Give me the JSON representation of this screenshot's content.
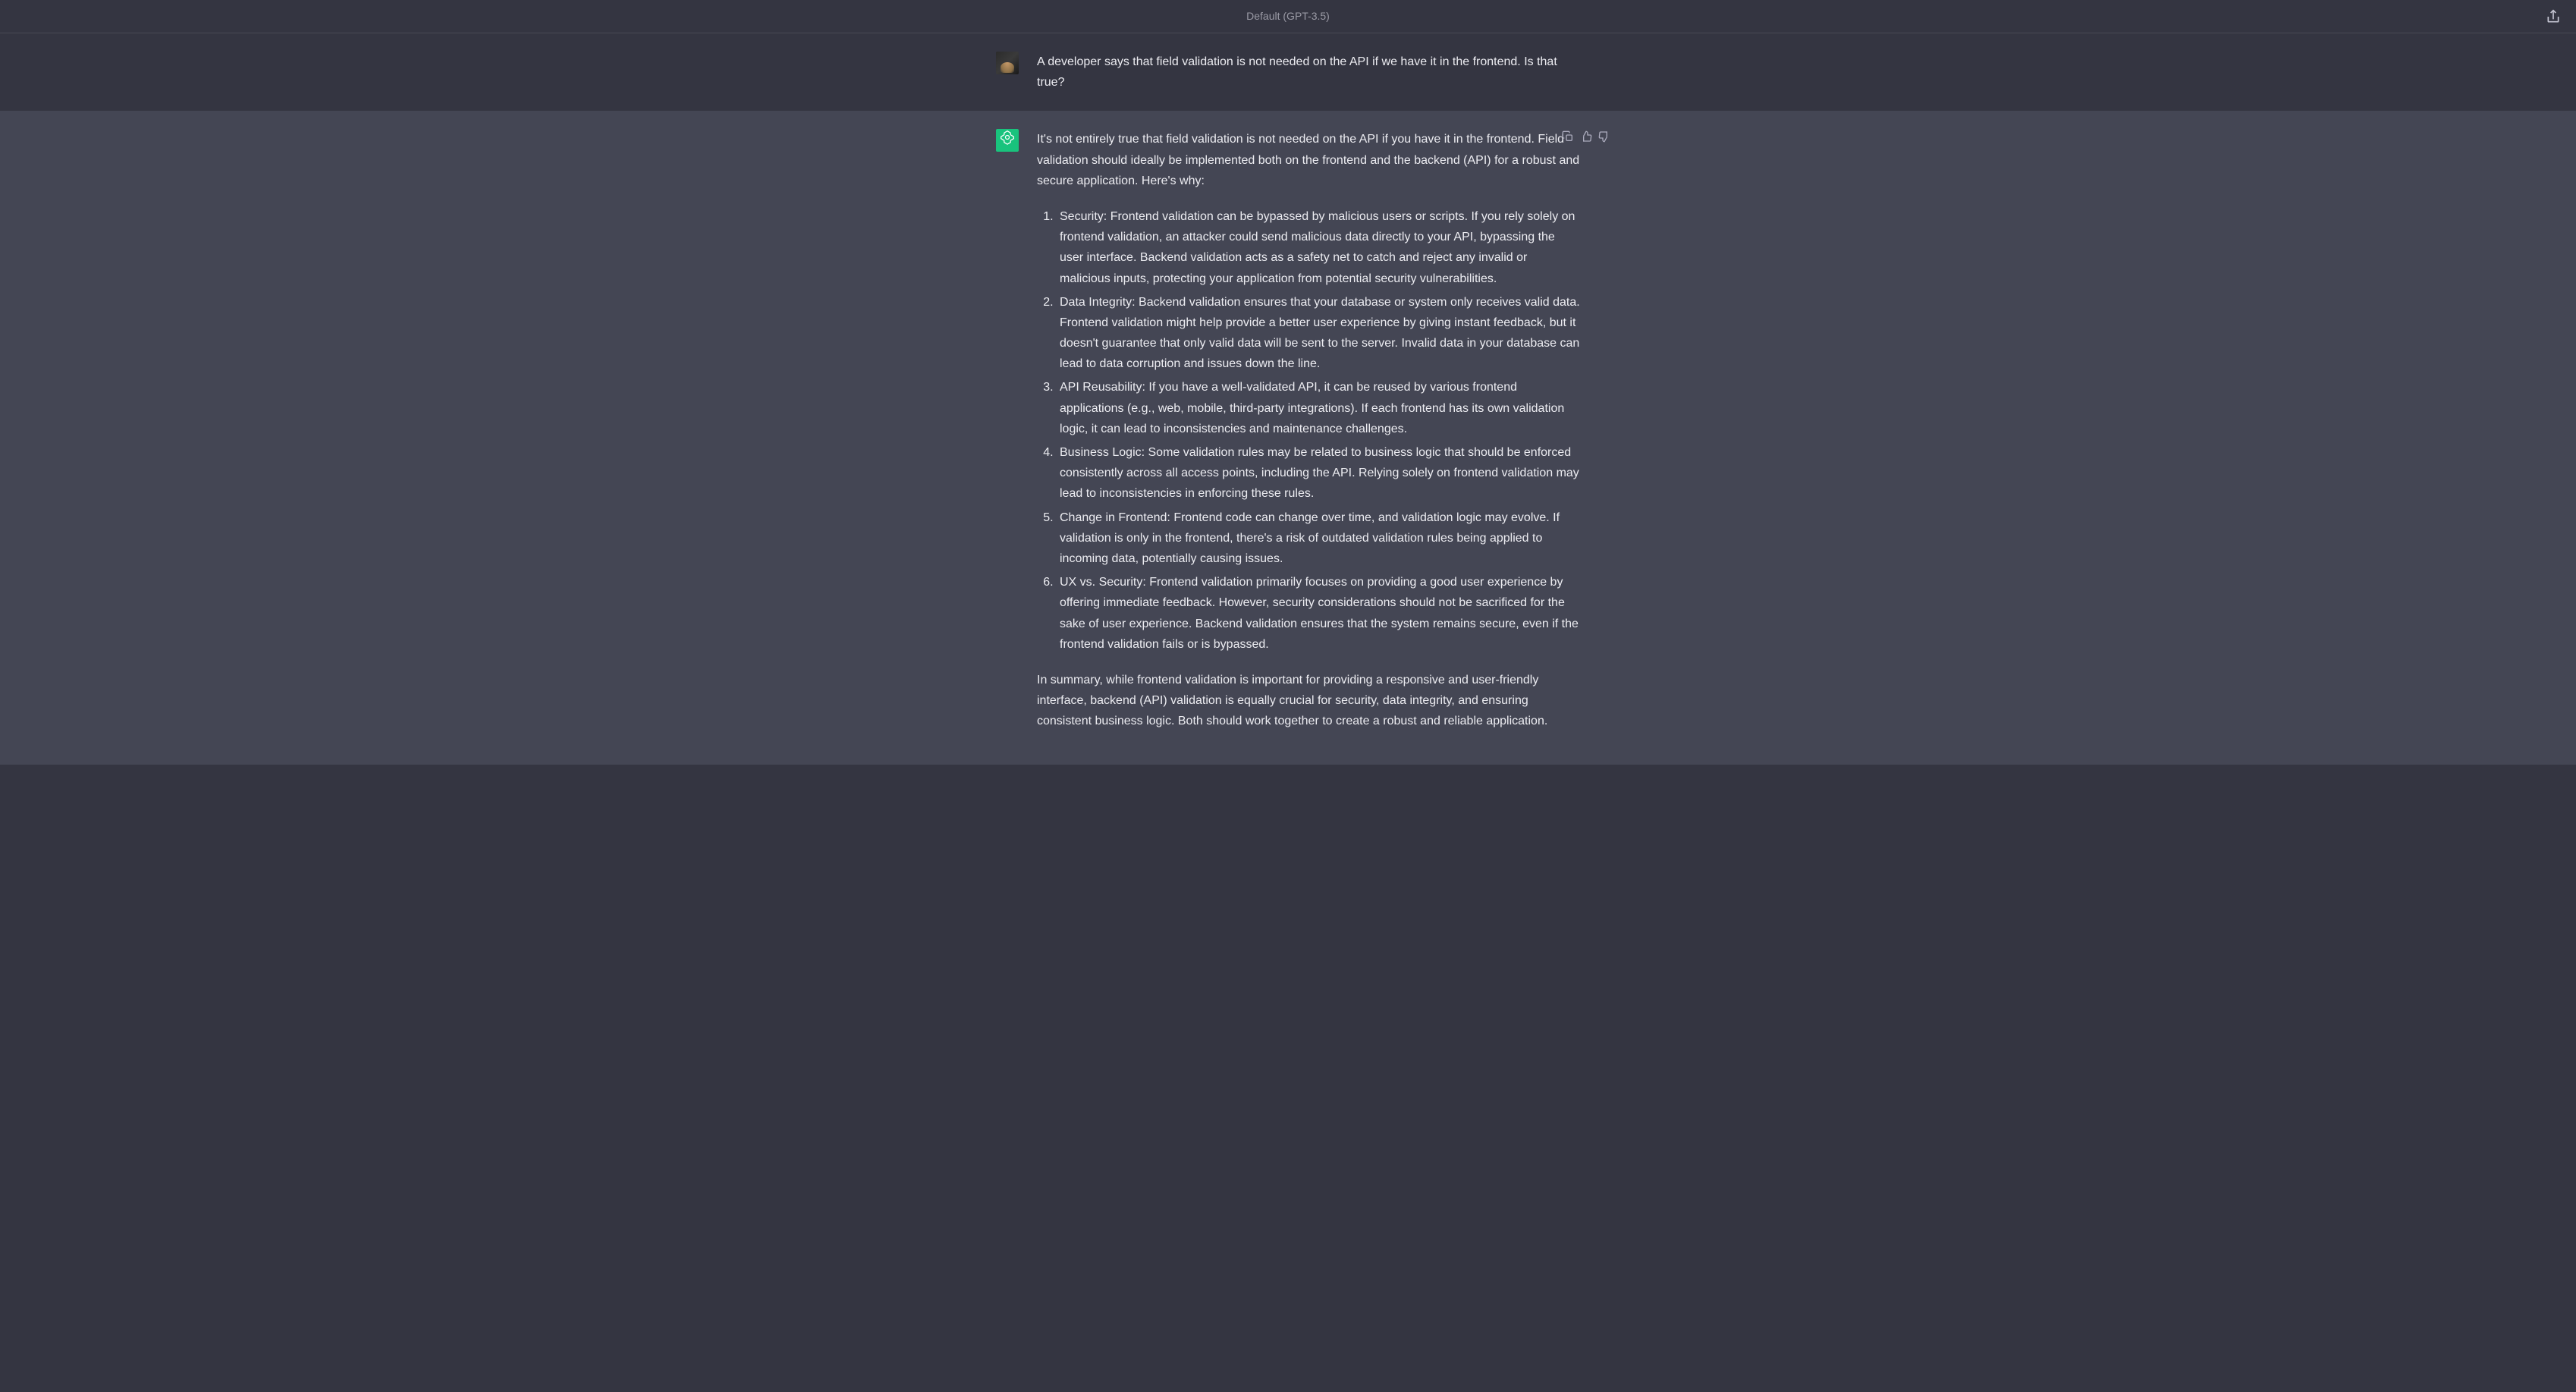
{
  "topbar": {
    "model_label": "Default (GPT-3.5)"
  },
  "messages": {
    "user_question": "A developer says that field validation is not needed on the API if we have it in the frontend. Is that true?",
    "assistant_intro": "It's not entirely true that field validation is not needed on the API if you have it in the frontend. Field validation should ideally be implemented both on the frontend and the backend (API) for a robust and secure application. Here's why:",
    "assistant_points": [
      "Security: Frontend validation can be bypassed by malicious users or scripts. If you rely solely on frontend validation, an attacker could send malicious data directly to your API, bypassing the user interface. Backend validation acts as a safety net to catch and reject any invalid or malicious inputs, protecting your application from potential security vulnerabilities.",
      "Data Integrity: Backend validation ensures that your database or system only receives valid data. Frontend validation might help provide a better user experience by giving instant feedback, but it doesn't guarantee that only valid data will be sent to the server. Invalid data in your database can lead to data corruption and issues down the line.",
      "API Reusability: If you have a well-validated API, it can be reused by various frontend applications (e.g., web, mobile, third-party integrations). If each frontend has its own validation logic, it can lead to inconsistencies and maintenance challenges.",
      "Business Logic: Some validation rules may be related to business logic that should be enforced consistently across all access points, including the API. Relying solely on frontend validation may lead to inconsistencies in enforcing these rules.",
      "Change in Frontend: Frontend code can change over time, and validation logic may evolve. If validation is only in the frontend, there's a risk of outdated validation rules being applied to incoming data, potentially causing issues.",
      "UX vs. Security: Frontend validation primarily focuses on providing a good user experience by offering immediate feedback. However, security considerations should not be sacrificed for the sake of user experience. Backend validation ensures that the system remains secure, even if the frontend validation fails or is bypassed."
    ],
    "assistant_summary": "In summary, while frontend validation is important for providing a responsive and user-friendly interface, backend (API) validation is equally crucial for security, data integrity, and ensuring consistent business logic. Both should work together to create a robust and reliable application."
  }
}
